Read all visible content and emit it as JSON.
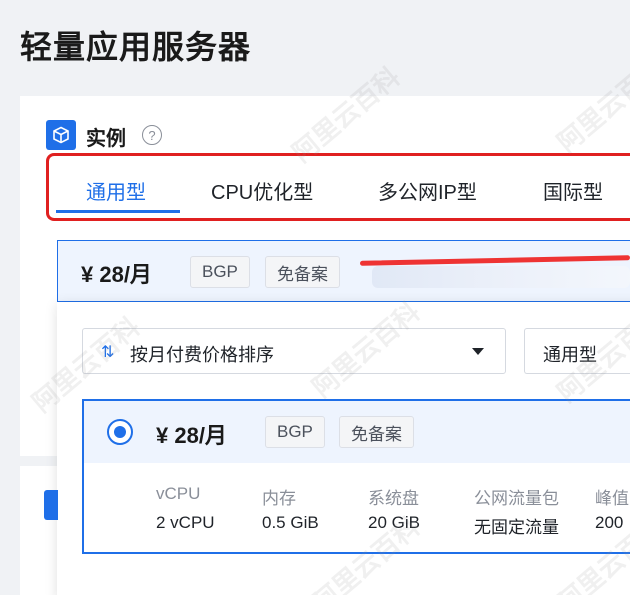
{
  "page": {
    "title": "轻量应用服务器"
  },
  "instance_section": {
    "label": "实例",
    "help_glyph": "?"
  },
  "tabs": [
    {
      "label": "通用型",
      "active": true
    },
    {
      "label": "CPU优化型",
      "active": false
    },
    {
      "label": "多公网IP型",
      "active": false
    },
    {
      "label": "国际型",
      "active": false
    }
  ],
  "summary": {
    "price": "¥ 28/月",
    "tags": [
      "BGP",
      "免备案"
    ]
  },
  "sort_select": {
    "label": "按月付费价格排序",
    "icon": "sort-arrows-icon",
    "glyph": "⇅"
  },
  "type_select": {
    "value": "通用型"
  },
  "option": {
    "price": "¥ 28/月",
    "tags": [
      "BGP",
      "免备案"
    ],
    "specs": [
      {
        "label": "vCPU",
        "value": "2 vCPU"
      },
      {
        "label": "内存",
        "value": "0.5 GiB"
      },
      {
        "label": "系统盘",
        "value": "20 GiB"
      },
      {
        "label": "公网流量包",
        "value": "无固定流量"
      },
      {
        "label": "峰值",
        "value": "200"
      }
    ]
  },
  "watermark": "阿里云百科",
  "colors": {
    "accent": "#1f6fe8",
    "annotation": "#e02020",
    "selected_bg": "#eef4fe"
  }
}
